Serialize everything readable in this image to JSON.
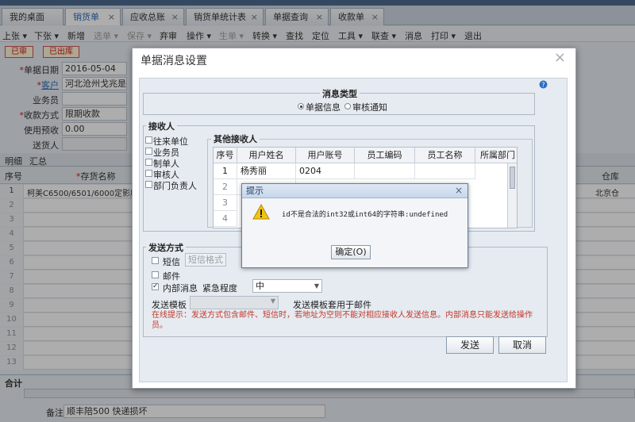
{
  "tabs": [
    {
      "label": "我的桌面",
      "closable": false
    },
    {
      "label": "销货单",
      "closable": true,
      "active": true
    },
    {
      "label": "应收总账",
      "closable": true
    },
    {
      "label": "销货单统计表",
      "closable": true
    },
    {
      "label": "单据查询",
      "closable": true
    },
    {
      "label": "收款单",
      "closable": true
    }
  ],
  "toolbar": {
    "items": [
      "上张",
      "下张",
      "新增",
      "选单",
      "保存",
      "弃审",
      "操作",
      "生单",
      "转换",
      "查找",
      "定位",
      "工具",
      "联查",
      "消息",
      "打印",
      "退出"
    ]
  },
  "status": {
    "audited": "已审",
    "outbound": "已出库"
  },
  "form": {
    "date_label": "单据日期",
    "date_value": "2016-05-04",
    "customer_label": "客户",
    "customer_value": "河北沧州戈兆是",
    "salesman_label": "业务员",
    "payment_label": "收款方式",
    "payment_value": "限期收款",
    "prepay_label": "使用预收",
    "prepay_value": "0.00",
    "deliverer_label": "送货人"
  },
  "grid": {
    "tab_detail": "明细",
    "tab_summary": "汇总",
    "col_no": "序号",
    "col_item": "存货名称",
    "col_warehouse": "仓库",
    "row1_no": "1",
    "row1_item": "柯美C6500/6501/6000定影膜",
    "row1_warehouse": "北京仓",
    "total_label": "合计"
  },
  "bottom": {
    "remark_label": "备注",
    "remark_value": "顺丰陪500 快递损坏"
  },
  "dialog": {
    "title": "单据消息设置",
    "msg_type_legend": "消息类型",
    "radio_doc_info": "单据信息",
    "radio_audit_notice": "审核通知",
    "receiver_legend": "接收人",
    "receivers": [
      "往来单位",
      "业务员",
      "制单人",
      "审核人",
      "部门负责人"
    ],
    "other_legend": "其他接收人",
    "recv_cols": [
      "序号",
      "用户姓名",
      "用户账号",
      "员工编码",
      "员工名称",
      "所属部门"
    ],
    "recv_row1": {
      "no": "1",
      "name": "杨秀丽",
      "account": "0204"
    },
    "recv_row_nos": [
      "1",
      "2",
      "3",
      "4"
    ],
    "send_legend": "发送方式",
    "sms_label": "短信",
    "sms_format_btn": "短信格式",
    "email_label": "邮件",
    "internal_label": "内部消息",
    "urgency_label": "紧急程度",
    "urgency_value": "中",
    "template_label": "发送模板",
    "template_note": "发送模板套用于邮件",
    "tip": "在线提示：发送方式包含邮件、短信时，若地址为空则不能对相应接收人发送信息。内部消息只能发送给操作员。",
    "send_btn": "发送",
    "cancel_btn": "取消"
  },
  "alert": {
    "title": "提示",
    "message": "id不是合法的int32或int64的字符串:undefined",
    "ok": "确定(O)"
  },
  "colors": {
    "accent": "#1a5fb4",
    "tip_text": "#c0392b",
    "warning": "#f1c40f"
  }
}
